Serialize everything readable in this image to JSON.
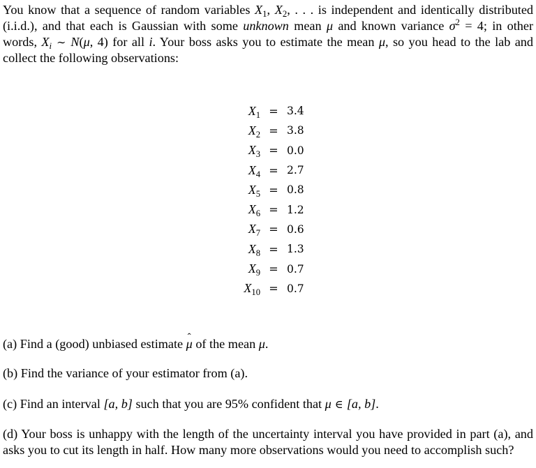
{
  "intro": {
    "line1_pre": "You know that a sequence of random variables ",
    "x1": "X",
    "x1_sub": "1",
    "comma1": ", ",
    "x2": "X",
    "x2_sub": "2",
    "line1_post": ", . . . is independent and identically distributed",
    "line2_pre": "(i.i.d.), and that each is Gaussian with some ",
    "line2_unknown": "unknown",
    "line2_mid": " mean ",
    "mu": "μ",
    "line2_mid2": " and known variance ",
    "sigma": "σ",
    "sigma_sup": "2",
    "line2_eq": " = 4; in other",
    "line3_pre": "words, ",
    "xi": "X",
    "xi_sub": "i",
    "sim": " ∼ ",
    "dist_n": "N",
    "dist_args_open": "(",
    "dist_args_close": ", 4)",
    "line3_mid": " for all ",
    "i": "i",
    "line3_post1": ". Your boss asks you to estimate the mean ",
    "line3_post2": ", so you head to the lab and",
    "line4": "collect the following observations:"
  },
  "observations": [
    {
      "var": "X",
      "sub": "1",
      "eq": "=",
      "value": "3.4"
    },
    {
      "var": "X",
      "sub": "2",
      "eq": "=",
      "value": "3.8"
    },
    {
      "var": "X",
      "sub": "3",
      "eq": "=",
      "value": "0.0"
    },
    {
      "var": "X",
      "sub": "4",
      "eq": "=",
      "value": "2.7"
    },
    {
      "var": "X",
      "sub": "5",
      "eq": "=",
      "value": "0.8"
    },
    {
      "var": "X",
      "sub": "6",
      "eq": "=",
      "value": "1.2"
    },
    {
      "var": "X",
      "sub": "7",
      "eq": "=",
      "value": "0.6"
    },
    {
      "var": "X",
      "sub": "8",
      "eq": "=",
      "value": "1.3"
    },
    {
      "var": "X",
      "sub": "9",
      "eq": "=",
      "value": "0.7"
    },
    {
      "var": "X",
      "sub": "10",
      "eq": "=",
      "value": "0.7"
    }
  ],
  "questions": {
    "a": {
      "pre": "(a) Find a (good) unbiased estimate ",
      "hat_mu": "μ",
      "mid": " of the mean ",
      "mu": "μ",
      "post": "."
    },
    "b": {
      "text": "(b) Find the variance of your estimator from (a)."
    },
    "c": {
      "pre": "(c) Find an interval ",
      "interval": "[a, b]",
      "mid": " such that you are 95% confident that ",
      "mu": "μ",
      "in": " ∈ ",
      "interval2": "[a, b]",
      "post": "."
    },
    "d": {
      "line1": "(d) Your boss is unhappy with the length of the uncertainty interval you have provided in part (a), and",
      "line2": "asks you to cut its length in half. How many more observations would you need to accomplish such?"
    }
  }
}
